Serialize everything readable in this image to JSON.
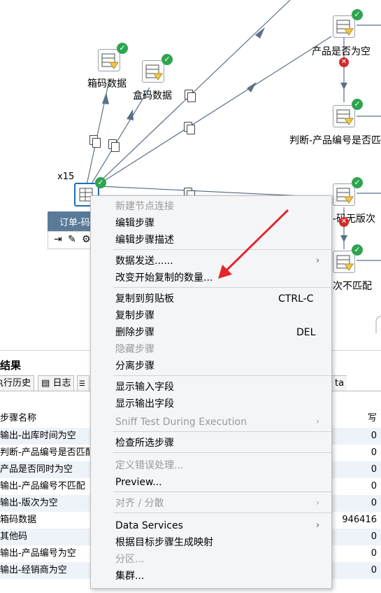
{
  "canvas": {
    "multiplier": "x15",
    "nodes": {
      "xiangma": "箱码数据",
      "hema": "盒码数据",
      "chanpin_empty": "产品是否为空",
      "judge_code": "判断-产品编号是否匹",
      "batch": "-码无版次",
      "mismatch": "次不匹配"
    },
    "tooltip_title": "订单-码"
  },
  "results": {
    "title": "结果",
    "tabs": [
      "执行历史",
      "日志",
      "ta"
    ],
    "columns": {
      "name": "步骤名称",
      "write": "写"
    },
    "rows": [
      {
        "name": "输出-出库时间为空",
        "value": "0"
      },
      {
        "name": "判断-产品编号是否匹配",
        "value": "0"
      },
      {
        "name": "产品是否同时为空",
        "value": "0"
      },
      {
        "name": "输出-产品编号不匹配",
        "value": "0"
      },
      {
        "name": "输出-版次为空",
        "value": "0"
      },
      {
        "name": "箱码数据",
        "value": "946416"
      },
      {
        "name": "其他码",
        "value": "0"
      },
      {
        "name": "输出-产品编号为空",
        "value": "0"
      },
      {
        "name": "输出-经销商为空",
        "value": "0"
      }
    ]
  },
  "menu": {
    "items": [
      {
        "label": "新建节点连接",
        "enabled": false
      },
      {
        "label": "编辑步骤",
        "enabled": true
      },
      {
        "label": "编辑步骤描述",
        "enabled": true
      },
      {
        "label": "数据发送......",
        "enabled": true,
        "submenu": true
      },
      {
        "label": "改变开始复制的数量...",
        "enabled": true
      },
      {
        "label": "复制到剪贴板",
        "enabled": true,
        "shortcut": "CTRL-C"
      },
      {
        "label": "复制步骤",
        "enabled": true
      },
      {
        "label": "删除步骤",
        "enabled": true,
        "shortcut": "DEL"
      },
      {
        "label": "隐藏步骤",
        "enabled": false
      },
      {
        "label": "分离步骤",
        "enabled": true
      },
      {
        "label": "显示输入字段",
        "enabled": true
      },
      {
        "label": "显示输出字段",
        "enabled": true
      },
      {
        "label": "Sniff Test During Execution",
        "enabled": false,
        "submenu": true
      },
      {
        "label": "检查所选步骤",
        "enabled": true
      },
      {
        "label": "定义错误处理...",
        "enabled": false
      },
      {
        "label": "Preview...",
        "enabled": true
      },
      {
        "label": "对齐 / 分散",
        "enabled": false,
        "submenu": true
      },
      {
        "label": "Data Services",
        "enabled": true,
        "submenu": true
      },
      {
        "label": "根据目标步骤生成映射",
        "enabled": true
      },
      {
        "label": "分区...",
        "enabled": false
      },
      {
        "label": "集群...",
        "enabled": true
      }
    ]
  },
  "colors": {
    "accent_arrow": "#e3262b",
    "ok": "#2ea44f",
    "hop": "#5a7089",
    "tooltip": "#5a7a99"
  }
}
